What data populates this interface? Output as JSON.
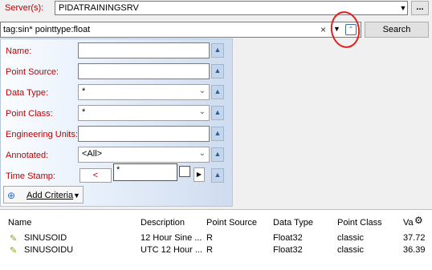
{
  "server": {
    "label": "Server(s):",
    "value": "PIDATRAININGSRV",
    "more_label": "..."
  },
  "query": {
    "value": "tag:sin* pointtype:float",
    "search_label": "Search"
  },
  "criteria": {
    "name_label": "Name:",
    "point_source_label": "Point Source:",
    "data_type_label": "Data Type:",
    "data_type_value": "*",
    "point_class_label": "Point Class:",
    "point_class_value": "*",
    "eng_units_label": "Engineering Units:",
    "annotated_label": "Annotated:",
    "annotated_value": "<All>",
    "timestamp_label": "Time Stamp:",
    "timestamp_op": "<",
    "timestamp_value": "*",
    "add_criteria_label": "Add Criteria"
  },
  "results": {
    "columns": [
      "Name",
      "Description",
      "Point Source",
      "Data Type",
      "Point Class",
      "Va"
    ],
    "rows": [
      {
        "name": "SINUSOID",
        "description": "12 Hour Sine ...",
        "point_source": "R",
        "data_type": "Float32",
        "point_class": "classic",
        "value": "37.72"
      },
      {
        "name": "SINUSOIDU",
        "description": "UTC 12 Hour ...",
        "point_source": "R",
        "data_type": "Float32",
        "point_class": "classic",
        "value": "36.39"
      }
    ]
  }
}
